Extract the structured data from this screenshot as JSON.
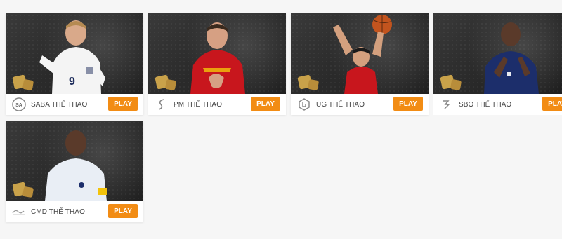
{
  "accent_color": "#f28c14",
  "cards": [
    {
      "name": "SABA THỂ THAO",
      "button": "PLAY",
      "logo": "saba-logo-icon",
      "kit": "white-england"
    },
    {
      "name": "PM THỂ THAO",
      "button": "PLAY",
      "logo": "pm-logo-icon",
      "kit": "red-spain"
    },
    {
      "name": "UG THỂ THAO",
      "button": "PLAY",
      "logo": "ug-logo-icon",
      "kit": "red-basketball"
    },
    {
      "name": "SBO THỂ THAO",
      "button": "PLAY",
      "logo": "sbo-logo-icon",
      "kit": "blue-france"
    },
    {
      "name": "CMD THỂ THAO",
      "button": "PLAY",
      "logo": "cmd-logo-icon",
      "kit": "white-france"
    }
  ]
}
